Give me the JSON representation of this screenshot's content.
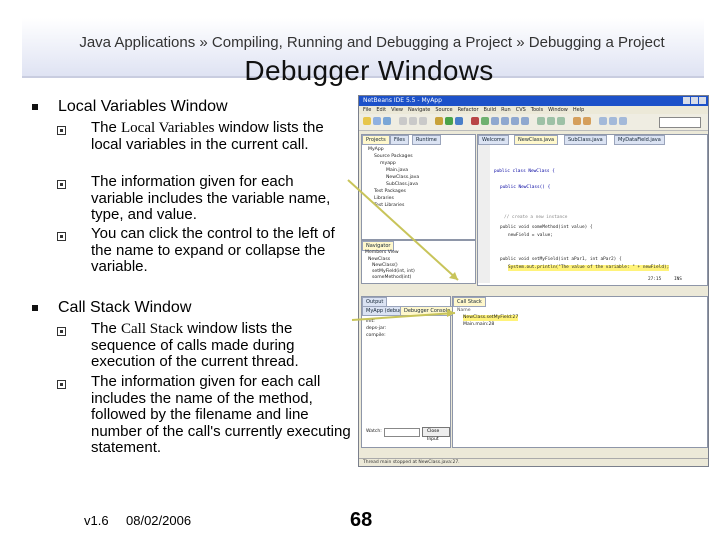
{
  "header": {
    "breadcrumb": "Java Applications » Compiling, Running and Debugging a Project » Debugging a Project",
    "title": "Debugger Windows"
  },
  "bullets": [
    {
      "heading": "Local Variables Window",
      "subs": [
        {
          "pre": "The ",
          "code": "Local Variables",
          "post": " window lists the local variables in the current call."
        },
        {
          "text": "The information given for each variable includes the variable name, type, and value."
        },
        {
          "text": "You can click the control to the left of the name to expand or collapse the variable."
        }
      ]
    },
    {
      "heading": "Call Stack Window",
      "subs": [
        {
          "pre": "The ",
          "code": "Call Stack",
          "post": " window lists the sequence of calls made during execution of the current thread."
        },
        {
          "text": "The information given for each call includes the name of the method, followed by the filename and line number of the call's currently executing statement."
        }
      ]
    }
  ],
  "footer": {
    "version": "v1.6",
    "date": "08/02/2006",
    "page": "68"
  },
  "ide": {
    "window_title": "NetBeans IDE 5.5 - MyApp",
    "menu": [
      "File",
      "Edit",
      "View",
      "Navigate",
      "Source",
      "Refactor",
      "Build",
      "Run",
      "CVS",
      "Tools",
      "Window",
      "Help"
    ],
    "projects_tabs": [
      "Projects",
      "Files",
      "Runtime"
    ],
    "tree": [
      "MyApp",
      "Source Packages",
      "myapp",
      "Main.java",
      "NewClass.java",
      "SubClass.java",
      "Test Packages",
      "Libraries",
      "Test Libraries"
    ],
    "editor_tabs": [
      "Welcome",
      "NewClass.java",
      "SubClass.java",
      "MyDataField.java"
    ],
    "code": [
      "public class NewClass {",
      "public NewClass() {",
      "// create a new instance",
      "public void someMethod(int value) {",
      "    newField = value;",
      "public void setMyField(int aPar1, int aPar2) {",
      "    System.out.println(\"The value of the variable: \" + newField);"
    ],
    "navigator_tabs": [
      "Navigator",
      "Members View"
    ],
    "navigator_items": [
      "NewClass",
      "NewClass()",
      "setMyField(int, int)",
      "someMethod(int)",
      "newField"
    ],
    "output_tabs": [
      "Output",
      "MyApp (debug)",
      "Debugger Console"
    ],
    "output_lines": [
      "init:",
      "deps-jar:",
      "compile:"
    ],
    "callstack_tab": "Call Stack",
    "callstack_header": "Name",
    "callstack_items": [
      "NewClass.setMyField:27",
      "Main.main:28"
    ],
    "status_text": "Thread main stopped at NewClass.java:27.",
    "position": "27:15",
    "mode": "INS",
    "watch_input_label": "Watch:",
    "button_label": "Close Input",
    "console_label": "Output",
    "colors": {
      "titlebar": "#1c51c9",
      "highlight": "#fff37a",
      "accent": "#c8c45a"
    }
  }
}
